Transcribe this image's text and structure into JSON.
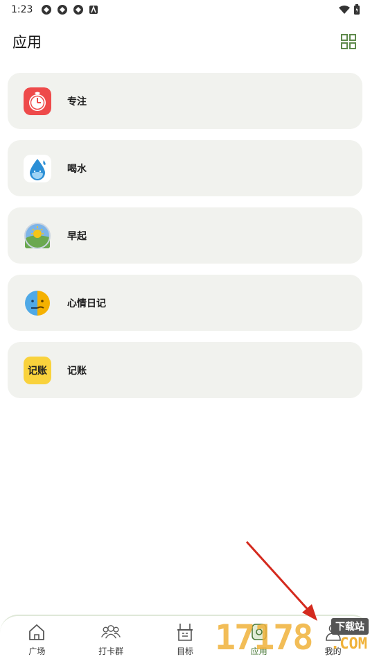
{
  "status": {
    "time": "1:23"
  },
  "header": {
    "title": "应用"
  },
  "apps": [
    {
      "label": "专注",
      "icon": "tomato-timer-icon"
    },
    {
      "label": "喝水",
      "icon": "water-drop-icon"
    },
    {
      "label": "早起",
      "icon": "sunrise-icon"
    },
    {
      "label": "心情日记",
      "icon": "mood-face-icon"
    },
    {
      "label": "记账",
      "icon": "ledger-icon",
      "icon_text": "记账"
    }
  ],
  "nav": [
    {
      "label": "广场",
      "icon": "home-icon"
    },
    {
      "label": "打卡群",
      "icon": "group-icon"
    },
    {
      "label": "目标",
      "icon": "target-icon"
    },
    {
      "label": "应用",
      "icon": "apps-icon",
      "active": true
    },
    {
      "label": "我的",
      "icon": "profile-icon"
    }
  ],
  "watermark": {
    "digits": "17178",
    "site": "下载站",
    "domain": ".COM"
  },
  "colors": {
    "accent": "#4a7a3a",
    "card_bg": "#f1f2ee",
    "arrow": "#d42a1e"
  }
}
